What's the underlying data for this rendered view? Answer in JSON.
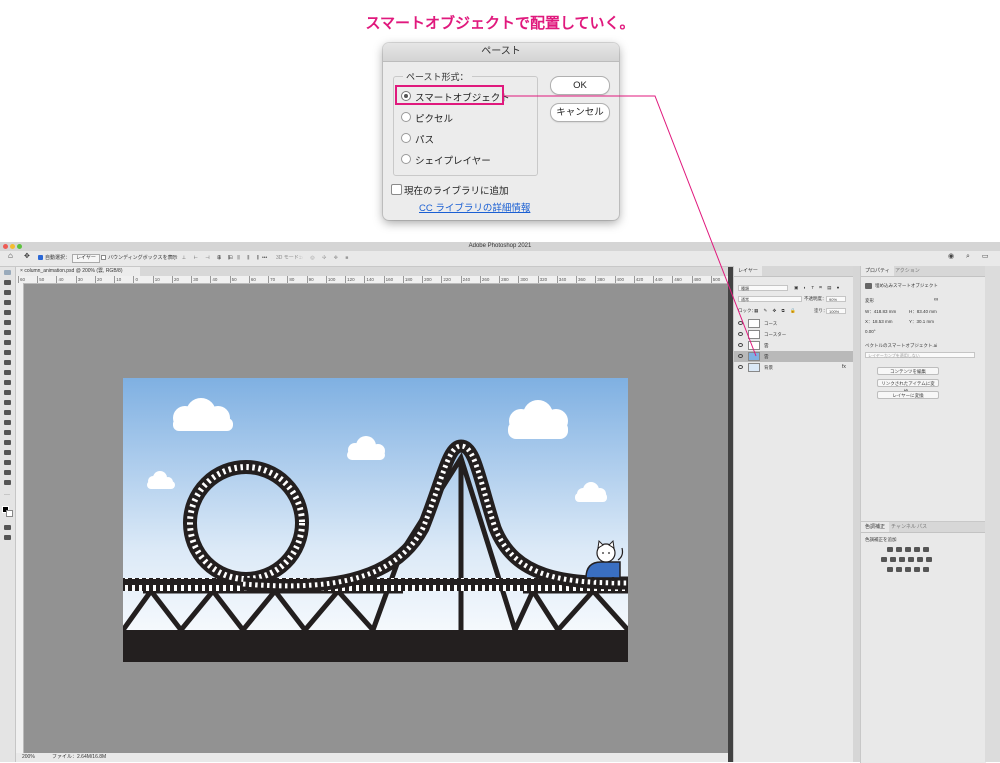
{
  "annotation": "スマートオブジェクトで配置していく。",
  "dialog": {
    "title": "ペースト",
    "format_group_label": "ペースト形式：",
    "options": [
      {
        "label": "スマートオブジェクト",
        "checked": true
      },
      {
        "label": "ピクセル",
        "checked": false
      },
      {
        "label": "パス",
        "checked": false
      },
      {
        "label": "シェイプレイヤー",
        "checked": false
      }
    ],
    "ok_label": "OK",
    "cancel_label": "キャンセル",
    "add_to_library_label": "現在のライブラリに追加",
    "add_to_library_checked": false,
    "cc_link": "CC ライブラリの詳細情報",
    "highlight_color": "#e0197d"
  },
  "ps": {
    "app_title": "Adobe Photoshop 2021",
    "options_bar": {
      "auto_select": "自動選択：",
      "layer_select": "レイヤー",
      "bounding_box": "バウンディングボックスを表示",
      "mode_3d": "3D モード："
    },
    "doc_tab": "column_animation.psd @ 200% (雲, RGB/8)",
    "ruler_ticks": [
      "60",
      "50",
      "40",
      "30",
      "20",
      "10",
      "0",
      "10",
      "20",
      "30",
      "40",
      "50",
      "60",
      "70",
      "80",
      "90",
      "100",
      "120",
      "140",
      "160",
      "180",
      "200",
      "220",
      "240",
      "260",
      "280",
      "300",
      "320",
      "340",
      "360",
      "380",
      "400",
      "420",
      "440",
      "460",
      "480",
      "500"
    ],
    "status": {
      "zoom": "200%",
      "file_info": "ファイル：2.64M/16.8M"
    },
    "layers_panel": {
      "tab": "レイヤー",
      "filter": "種類",
      "blend_mode": "通常",
      "opacity_label": "不透明度：",
      "opacity": "90%",
      "lock_label": "ロック：",
      "fill_label": "塗り：",
      "fill": "100%",
      "layers": [
        {
          "name": "コース",
          "selected": false
        },
        {
          "name": "コースター",
          "selected": false
        },
        {
          "name": "雲",
          "selected": false
        },
        {
          "name": "雲",
          "selected": true
        },
        {
          "name": "背景",
          "selected": false
        }
      ]
    },
    "properties_panel": {
      "tabs": [
        "プロパティ",
        "アクション"
      ],
      "type_label": "埋め込みスマートオブジェクト",
      "transform_label": "変形",
      "w": "W：418.83 mm",
      "h": "H：83.40 mm",
      "x": "X：18.53 mm",
      "y": "Y：30.1 mm",
      "angle": "0.00°",
      "vector_label": "ベクトルのスマートオブジェクト.ai",
      "comp_placeholder": "レイヤーカンプを適用しない",
      "buttons": [
        "コンテンツを編集",
        "リンクされたアイテムに変換...",
        "レイヤーに変換"
      ]
    },
    "adjust_panel": {
      "tabs": [
        "色調補正",
        "チャンネル",
        "パス"
      ],
      "label": "色調補正を追加"
    }
  }
}
